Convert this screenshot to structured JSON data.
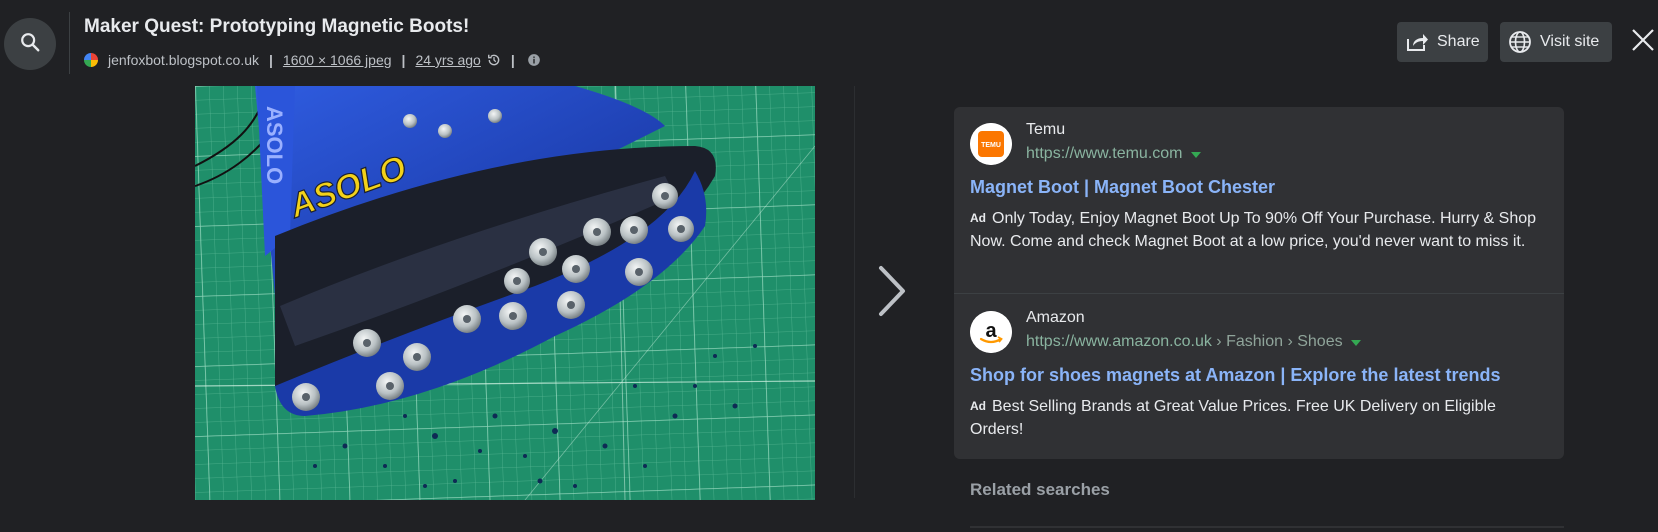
{
  "header": {
    "title": "Maker Quest: Prototyping Magnetic Boots!",
    "source": "jenfoxbot.blogspot.co.uk",
    "dimensions": "1600 × 1066 jpeg",
    "age": "24 yrs ago",
    "separator": "|"
  },
  "actions": {
    "share_label": "Share",
    "visit_label": "Visit site"
  },
  "image": {
    "brand_text": "ASOLO",
    "tongue_text": "ASOLO"
  },
  "ads": [
    {
      "name": "Temu",
      "logo_text": "TEMU",
      "url": "https://www.temu.com",
      "crumbs": "",
      "headline": "Magnet Boot | Magnet Boot Chester",
      "badge": "Ad",
      "description": "Only Today, Enjoy Magnet Boot Up To 90% Off Your Purchase. Hurry & Shop Now. Come and check Magnet Boot at a low price, you'd never want to miss it."
    },
    {
      "name": "Amazon",
      "logo_text": "a",
      "url": "https://www.amazon.co.uk",
      "crumbs": " › Fashion › Shoes",
      "headline": "Shop for shoes magnets at Amazon | Explore the latest trends",
      "badge": "Ad",
      "description": "Best Selling Brands at Great Value Prices. Free UK Delivery on Eligible Orders!"
    }
  ],
  "related": {
    "title": "Related searches"
  },
  "colors": {
    "background": "#202124",
    "link": "#8ab4f8",
    "temu": "#fb7701",
    "boot_blue": "#1e46c8",
    "mat_green": "#1f8f6a"
  },
  "icons": [
    "search-icon",
    "share-icon",
    "globe-icon",
    "close-icon",
    "history-icon",
    "info-icon",
    "chevron-right-icon",
    "caret-down-icon"
  ]
}
